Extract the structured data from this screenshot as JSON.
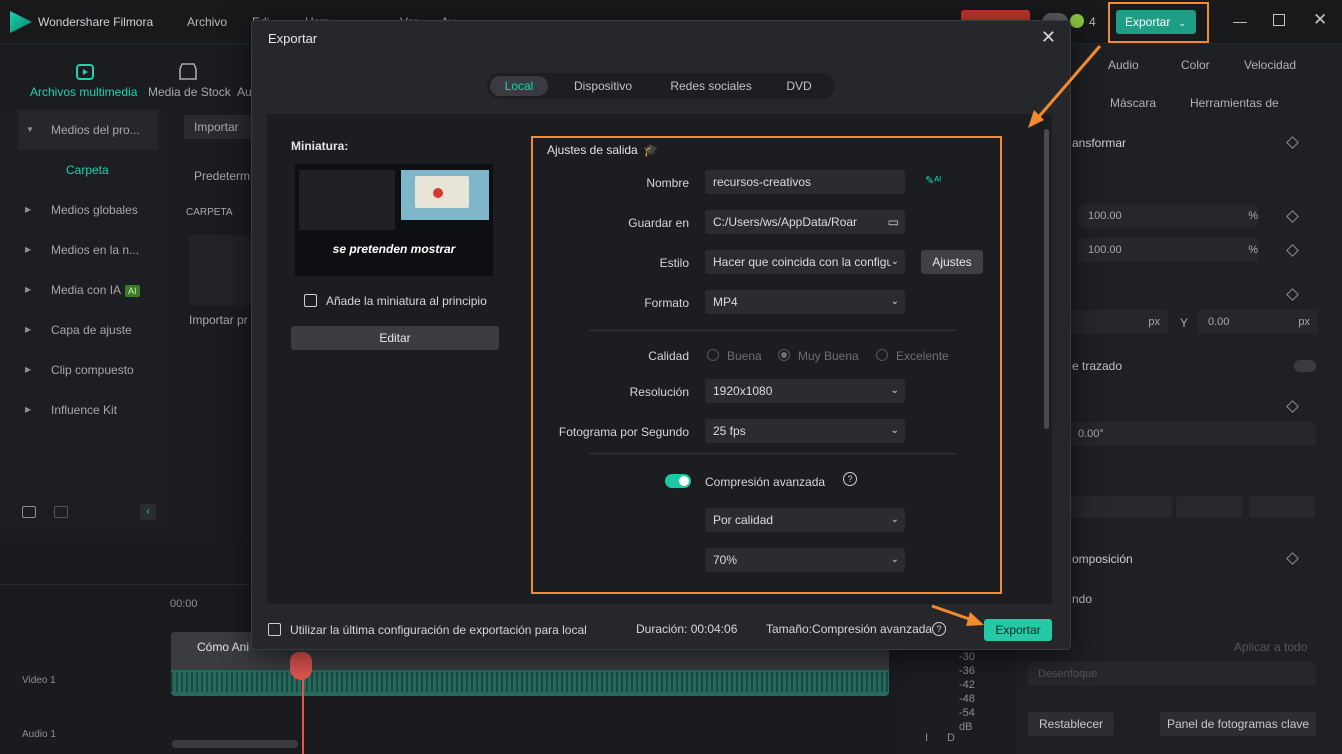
{
  "app": {
    "title": "Wondershare Filmora",
    "menu": [
      "Archivo",
      "Edi",
      "Herr",
      "Ver",
      "Ay"
    ],
    "top_export": "Exportar",
    "notif_count": "4"
  },
  "toolbar": {
    "media": "Archivos multimedia",
    "stock": "Media de Stock",
    "audio_short": "Au"
  },
  "sidebar": {
    "items": [
      "Medios del pro...",
      "Carpeta",
      "Medios globales",
      "Medios en la n...",
      "Media con IA",
      "Capa de ajuste",
      "Clip compuesto",
      "Influence Kit"
    ],
    "ai_badge": "AI"
  },
  "media_panel": {
    "import": "Importar",
    "preset": "Predeterm",
    "folder_header": "CARPETA",
    "import_pr": "Importar pr"
  },
  "right_panel": {
    "tabs": [
      "Audio",
      "Color",
      "Velocidad"
    ],
    "subtabs": [
      "Máscara",
      "Herramientas de"
    ],
    "transform": "ansformar",
    "scale1": "100.00",
    "scale2": "100.00",
    "pct": "%",
    "px": "px",
    "y_label": "Y",
    "y_val": "0.00",
    "trazado": "e trazado",
    "rotation": "0.00°",
    "composicion": "omposición",
    "ndo": "ndo",
    "aplicar": "Aplicar a todo",
    "desenfoque": "Desenfoque",
    "restablecer": "Restablecer",
    "panel_kf": "Panel de fotogramas clave"
  },
  "timeline": {
    "time": "00:00",
    "video_track": "Video 1",
    "audio_track": "Audio 1",
    "clip_title": "Cómo Ani",
    "db": [
      "-30",
      "-36",
      "-42",
      "-48",
      "-54",
      "dB"
    ],
    "meters": [
      "I",
      "D"
    ]
  },
  "modal": {
    "title": "Exportar",
    "tabs": [
      "Local",
      "Dispositivo",
      "Redes sociales",
      "DVD"
    ],
    "thumbnail_label": "Miniatura:",
    "thumbnail_caption": "se pretenden mostrar",
    "add_thumb": "Añade la miniatura al principio",
    "edit": "Editar",
    "settings_title": "Ajustes de salida",
    "name_label": "Nombre",
    "name_value": "recursos-creativos",
    "save_label": "Guardar en",
    "save_value": "C:/Users/ws/AppData/Roar",
    "style_label": "Estilo",
    "style_value": "Hacer que coincida con la configu",
    "settings_btn": "Ajustes",
    "format_label": "Formato",
    "format_value": "MP4",
    "quality_label": "Calidad",
    "quality_options": [
      "Buena",
      "Muy Buena",
      "Excelente"
    ],
    "resolution_label": "Resolución",
    "resolution_value": "1920x1080",
    "fps_label": "Fotograma por Segundo",
    "fps_value": "25 fps",
    "compression_label": "Compresión avanzada",
    "compression_mode": "Por calidad",
    "compression_pct": "70%",
    "use_last": "Utilizar la última configuración de exportación para local",
    "duration": "Duración: 00:04:06",
    "size": "Tamaño:Compresión avanzada",
    "export": "Exportar"
  }
}
